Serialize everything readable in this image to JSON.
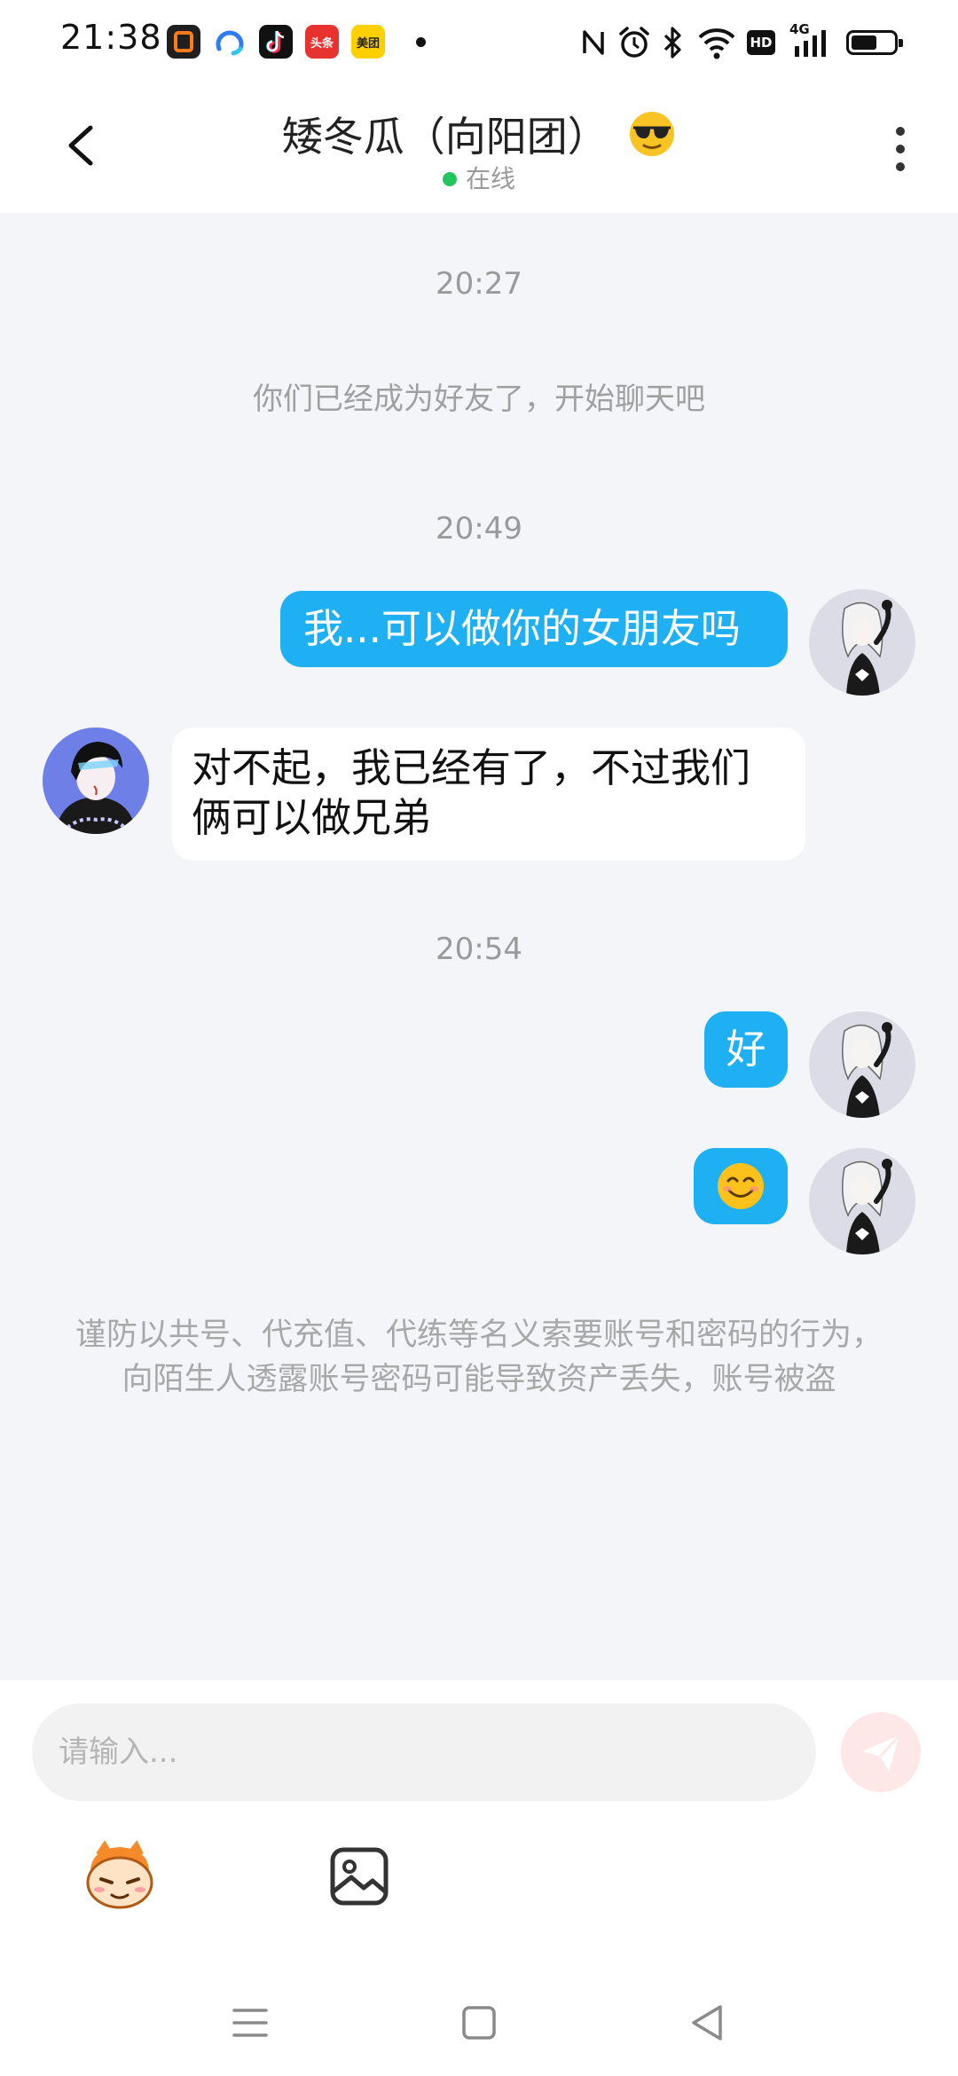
{
  "status_bar": {
    "time": "21:38",
    "app_icons": [
      {
        "name": "office-app-icon",
        "label": "O",
        "color": "#e85d0c"
      },
      {
        "name": "browser-app-icon",
        "label": "",
        "color": "#3b82f6"
      },
      {
        "name": "tiktok-app-icon",
        "label": "",
        "color": "#111111"
      },
      {
        "name": "toutiao-app-icon",
        "label": "头条",
        "color": "#e8322f"
      },
      {
        "name": "meituan-app-icon",
        "label": "美团",
        "color": "#ffd000"
      }
    ],
    "network": "4G",
    "hd_label": "HD"
  },
  "header": {
    "title": "矮冬瓜（向阳团）",
    "status": "在线"
  },
  "chat": {
    "time_1": "20:27",
    "friend_notice": "你们已经成为好友了，开始聊天吧",
    "time_2": "20:49",
    "msg_out_1": "我...可以做你的女朋友吗",
    "msg_in_1": "对不起，我已经有了，不过我们俩可以做兄弟",
    "time_3": "20:54",
    "msg_out_2": "好",
    "msg_out_3": "😊",
    "warning": "谨防以共号、代充值、代练等名义索要账号和密码的行为，向陌生人透露账号密码可能导致资产丢失，账号被盗"
  },
  "input": {
    "placeholder": "请输入..."
  },
  "colors": {
    "outgoing_bubble": "#1fb0f3",
    "incoming_bubble": "#ffffff",
    "chat_background": "#f3f5f8",
    "online_dot": "#22c55e",
    "send_button_disabled": "#fde7e7"
  }
}
